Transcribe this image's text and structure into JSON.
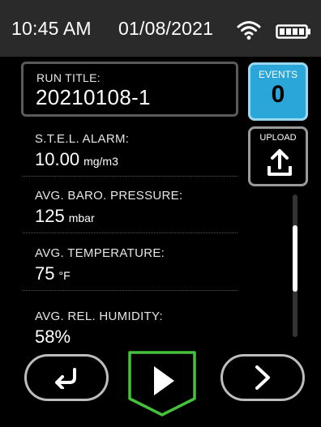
{
  "status_bar": {
    "time": "10:45 AM",
    "date": "01/08/2021",
    "wifi_icon": "wifi-icon",
    "battery_icon": "battery-icon"
  },
  "run_title": {
    "label": "RUN TITLE:",
    "value": "20210108-1"
  },
  "rows": [
    {
      "label": "S.T.E.L. ALARM:",
      "value": "10.00",
      "unit": "mg/m3"
    },
    {
      "label": "AVG. BARO. PRESSURE:",
      "value": "125",
      "unit": "mbar"
    },
    {
      "label": "AVG. TEMPERATURE:",
      "value": "75",
      "unit": "°F"
    },
    {
      "label": "AVG. REL. HUMIDITY:",
      "value": "58%",
      "unit": ""
    }
  ],
  "events": {
    "label": "EVENTS",
    "count": "0"
  },
  "upload": {
    "label": "UPLOAD",
    "icon": "upload-icon"
  },
  "scrollbar": {
    "position_fraction": 0.4
  },
  "nav": {
    "back_icon": "return-arrow-icon",
    "play_icon": "play-icon",
    "next_icon": "chevron-right-icon"
  },
  "colors": {
    "accent_blue": "#2aa7d8",
    "play_green": "#45c13c",
    "status_bar_bg": "#2a2a2a"
  }
}
